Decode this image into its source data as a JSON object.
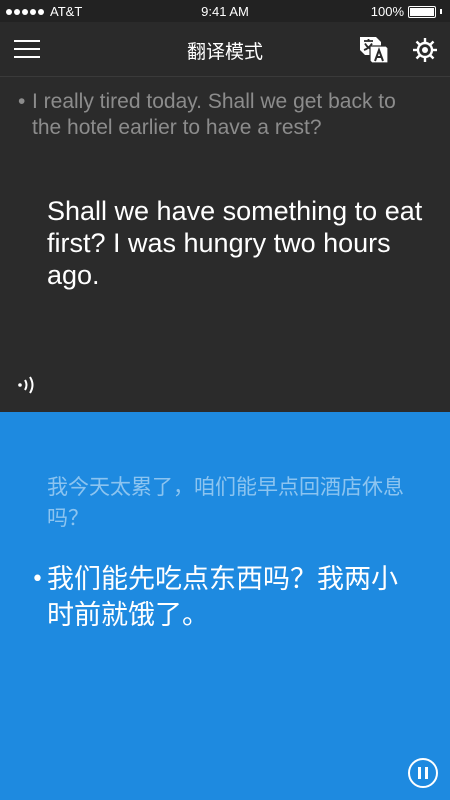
{
  "status_bar": {
    "carrier": "AT&T",
    "time": "9:41 AM",
    "battery": "100%",
    "battery_level": 1.0
  },
  "nav": {
    "title": "翻译模式"
  },
  "top_panel": {
    "previous_text": "I really tired today. Shall we get back to the hotel earlier to have a rest?",
    "current_text": "Shall we have something to eat first? I was hungry two hours ago."
  },
  "bottom_panel": {
    "previous_text": "我今天太累了，咱们能早点回酒店休息吗？",
    "current_text": "我们能先吃点东西吗？我两小时前就饿了。"
  },
  "icons": {
    "menu": "menu-icon",
    "translate": "translate-icon",
    "settings": "gear-icon",
    "speaker": "speaker-icon",
    "pause": "pause-icon"
  },
  "colors": {
    "top_background": "#2b2b2b",
    "bottom_background": "#1e8ae0",
    "muted_text_dark": "#8c8c8c",
    "muted_text_blue": "#8cc4f0"
  }
}
